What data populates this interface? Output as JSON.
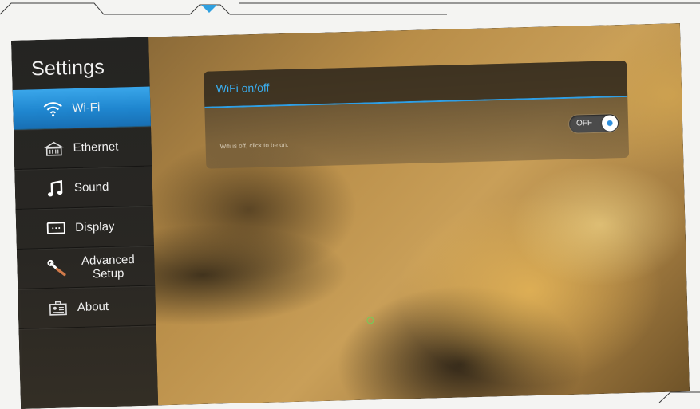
{
  "sidebar": {
    "title": "Settings",
    "items": [
      {
        "label": "Wi-Fi",
        "icon": "wifi-icon",
        "active": true
      },
      {
        "label": "Ethernet",
        "icon": "ethernet-icon",
        "active": false
      },
      {
        "label": "Sound",
        "icon": "music-note-icon",
        "active": false
      },
      {
        "label": "Display",
        "icon": "display-icon",
        "active": false
      },
      {
        "label": "Advanced Setup",
        "icon": "wrench-icon",
        "active": false
      },
      {
        "label": "About",
        "icon": "about-icon",
        "active": false
      }
    ]
  },
  "wifi_panel": {
    "title": "WiFi on/off",
    "description": "Wifi is off, click to be on.",
    "toggle_label": "OFF",
    "enabled": false
  },
  "colors": {
    "accent": "#2e9fe6",
    "sidebar_active": "#1f86cf",
    "sidebar_bg": "#2a2926"
  }
}
